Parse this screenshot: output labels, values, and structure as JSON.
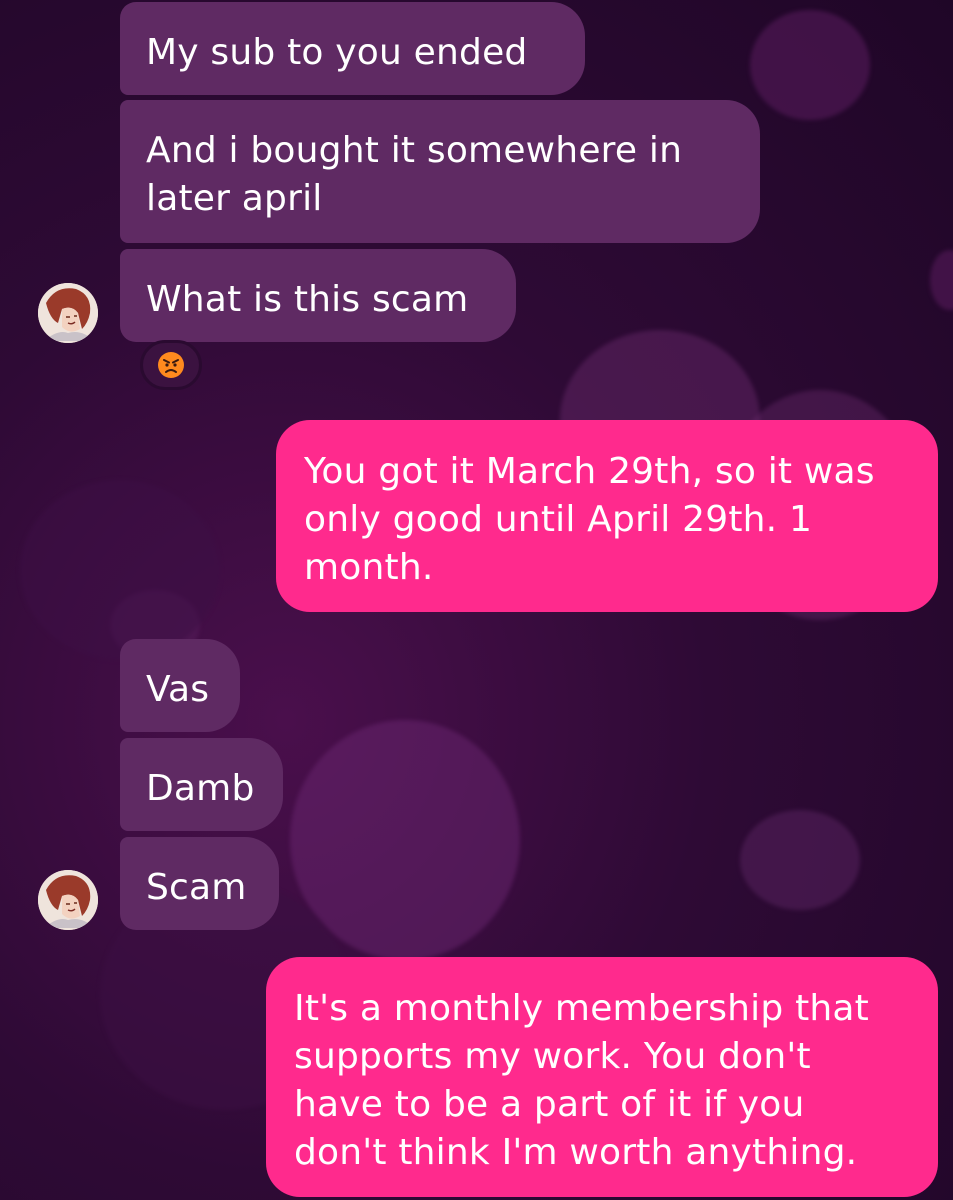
{
  "conversation": {
    "incoming_group_1": [
      "My sub to you ended",
      "And i bought it somewhere in later april",
      "What is this scam"
    ],
    "reaction_icon": "angry-face-icon",
    "outgoing_1": "You got it March 29th, so it was only good until April 29th. 1 month.",
    "incoming_group_2": [
      "Vas",
      "Damb",
      "Scam"
    ],
    "outgoing_2": "It's a monthly membership that supports my work. You don't have to be a part of it if you don't think I'm worth anything."
  },
  "colors": {
    "incoming_bubble": "#5f2a63",
    "outgoing_bubble": "#ff2a8d",
    "background": "#2e0a35"
  }
}
